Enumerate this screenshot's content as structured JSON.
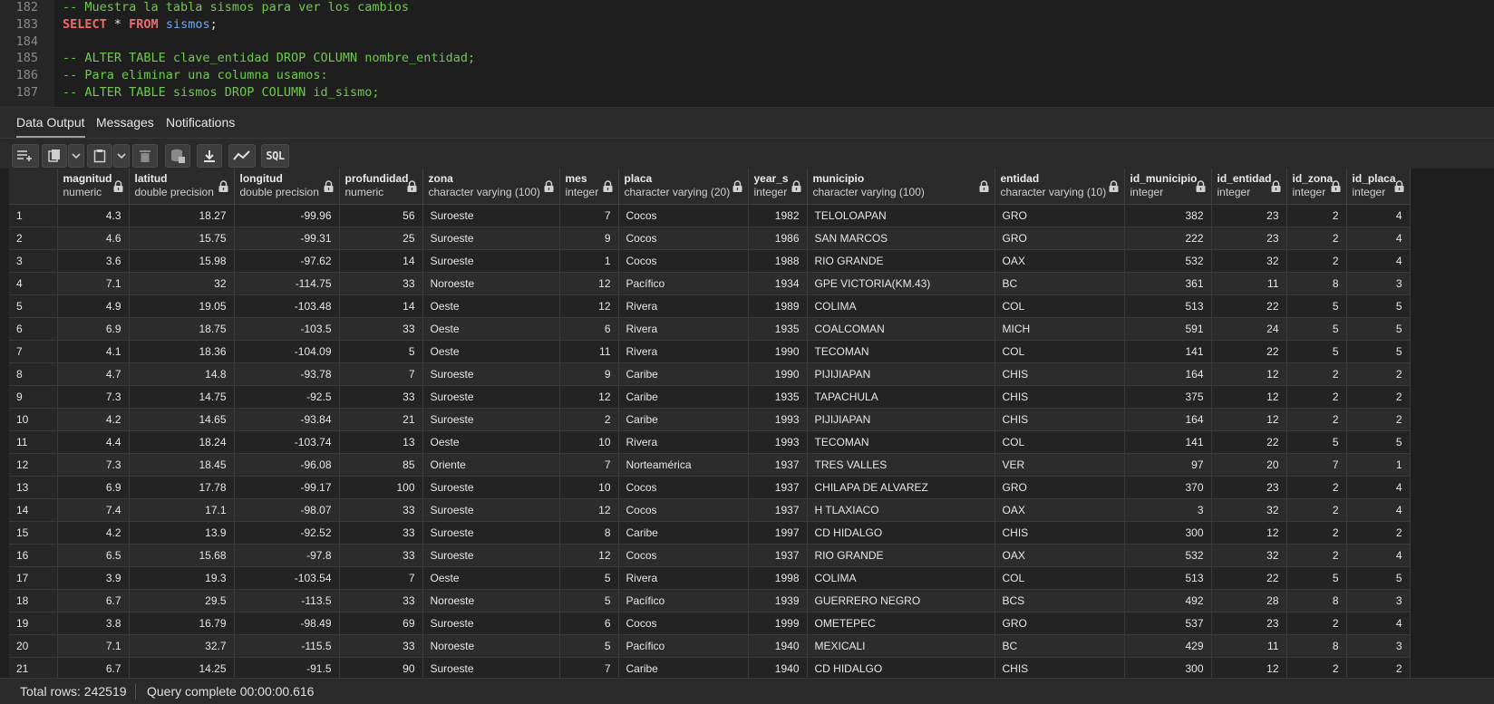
{
  "editor": {
    "lines": [
      {
        "n": "182",
        "tokens": [
          {
            "t": "-- Muestra la tabla sismos para ver los cambios",
            "c": "comment"
          }
        ]
      },
      {
        "n": "183",
        "tokens": [
          {
            "t": "SELECT",
            "c": "kw"
          },
          {
            "t": " * ",
            "c": "op"
          },
          {
            "t": "FROM",
            "c": "kw"
          },
          {
            "t": " sismos",
            "c": "id"
          },
          {
            "t": ";",
            "c": "op"
          }
        ]
      },
      {
        "n": "184",
        "tokens": []
      },
      {
        "n": "185",
        "tokens": [
          {
            "t": "-- ALTER TABLE clave_entidad DROP COLUMN nombre_entidad;",
            "c": "comment"
          }
        ]
      },
      {
        "n": "186",
        "tokens": [
          {
            "t": "-- Para eliminar una columna usamos:",
            "c": "comment"
          }
        ]
      },
      {
        "n": "187",
        "tokens": [
          {
            "t": "-- ALTER TABLE sismos DROP COLUMN id_sismo;",
            "c": "comment"
          }
        ]
      }
    ]
  },
  "tabs": [
    {
      "label": "Data Output",
      "active": true
    },
    {
      "label": "Messages",
      "active": false
    },
    {
      "label": "Notifications",
      "active": false
    }
  ],
  "toolbar": {
    "sql_label": "SQL",
    "buttons": [
      "add-row-icon",
      "copy-icon",
      "dropdown-icon",
      "paste-icon",
      "dropdown-icon",
      "delete-icon",
      "save-data-icon",
      "download-icon",
      "graph-visualiser-icon",
      "sql-icon"
    ]
  },
  "grid": {
    "columns": [
      {
        "name": "magnitud",
        "type": "numeric",
        "align": "num"
      },
      {
        "name": "latitud",
        "type": "double precision",
        "align": "num"
      },
      {
        "name": "longitud",
        "type": "double precision",
        "align": "num"
      },
      {
        "name": "profundidad",
        "type": "numeric",
        "align": "num"
      },
      {
        "name": "zona",
        "type": "character varying (100)",
        "align": "text"
      },
      {
        "name": "mes",
        "type": "integer",
        "align": "num"
      },
      {
        "name": "placa",
        "type": "character varying (20)",
        "align": "text"
      },
      {
        "name": "year_s",
        "type": "integer",
        "align": "num"
      },
      {
        "name": "municipio",
        "type": "character varying (100)",
        "align": "text"
      },
      {
        "name": "entidad",
        "type": "character varying (10)",
        "align": "text"
      },
      {
        "name": "id_municipio",
        "type": "integer",
        "align": "num"
      },
      {
        "name": "id_entidad",
        "type": "integer",
        "align": "num"
      },
      {
        "name": "id_zona",
        "type": "integer",
        "align": "num"
      },
      {
        "name": "id_placa",
        "type": "integer",
        "align": "num"
      }
    ],
    "rows": [
      [
        "1",
        "4.3",
        "18.27",
        "-99.96",
        "56",
        "Suroeste",
        "7",
        "Cocos",
        "1982",
        "TELOLOAPAN",
        "GRO",
        "382",
        "23",
        "2",
        "4"
      ],
      [
        "2",
        "4.6",
        "15.75",
        "-99.31",
        "25",
        "Suroeste",
        "9",
        "Cocos",
        "1986",
        "SAN MARCOS",
        "GRO",
        "222",
        "23",
        "2",
        "4"
      ],
      [
        "3",
        "3.6",
        "15.98",
        "-97.62",
        "14",
        "Suroeste",
        "1",
        "Cocos",
        "1988",
        "RIO GRANDE",
        "OAX",
        "532",
        "32",
        "2",
        "4"
      ],
      [
        "4",
        "7.1",
        "32",
        "-114.75",
        "33",
        "Noroeste",
        "12",
        "Pacífico",
        "1934",
        "GPE VICTORIA(KM.43)",
        "BC",
        "361",
        "11",
        "8",
        "3"
      ],
      [
        "5",
        "4.9",
        "19.05",
        "-103.48",
        "14",
        "Oeste",
        "12",
        "Rivera",
        "1989",
        "COLIMA",
        "COL",
        "513",
        "22",
        "5",
        "5"
      ],
      [
        "6",
        "6.9",
        "18.75",
        "-103.5",
        "33",
        "Oeste",
        "6",
        "Rivera",
        "1935",
        "COALCOMAN",
        "MICH",
        "591",
        "24",
        "5",
        "5"
      ],
      [
        "7",
        "4.1",
        "18.36",
        "-104.09",
        "5",
        "Oeste",
        "11",
        "Rivera",
        "1990",
        "TECOMAN",
        "COL",
        "141",
        "22",
        "5",
        "5"
      ],
      [
        "8",
        "4.7",
        "14.8",
        "-93.78",
        "7",
        "Suroeste",
        "9",
        "Caribe",
        "1990",
        "PIJIJIAPAN",
        "CHIS",
        "164",
        "12",
        "2",
        "2"
      ],
      [
        "9",
        "7.3",
        "14.75",
        "-92.5",
        "33",
        "Suroeste",
        "12",
        "Caribe",
        "1935",
        "TAPACHULA",
        "CHIS",
        "375",
        "12",
        "2",
        "2"
      ],
      [
        "10",
        "4.2",
        "14.65",
        "-93.84",
        "21",
        "Suroeste",
        "2",
        "Caribe",
        "1993",
        "PIJIJIAPAN",
        "CHIS",
        "164",
        "12",
        "2",
        "2"
      ],
      [
        "11",
        "4.4",
        "18.24",
        "-103.74",
        "13",
        "Oeste",
        "10",
        "Rivera",
        "1993",
        "TECOMAN",
        "COL",
        "141",
        "22",
        "5",
        "5"
      ],
      [
        "12",
        "7.3",
        "18.45",
        "-96.08",
        "85",
        "Oriente",
        "7",
        "Norteamérica",
        "1937",
        "TRES VALLES",
        "VER",
        "97",
        "20",
        "7",
        "1"
      ],
      [
        "13",
        "6.9",
        "17.78",
        "-99.17",
        "100",
        "Suroeste",
        "10",
        "Cocos",
        "1937",
        "CHILAPA DE ALVAREZ",
        "GRO",
        "370",
        "23",
        "2",
        "4"
      ],
      [
        "14",
        "7.4",
        "17.1",
        "-98.07",
        "33",
        "Suroeste",
        "12",
        "Cocos",
        "1937",
        "H TLAXIACO",
        "OAX",
        "3",
        "32",
        "2",
        "4"
      ],
      [
        "15",
        "4.2",
        "13.9",
        "-92.52",
        "33",
        "Suroeste",
        "8",
        "Caribe",
        "1997",
        "CD HIDALGO",
        "CHIS",
        "300",
        "12",
        "2",
        "2"
      ],
      [
        "16",
        "6.5",
        "15.68",
        "-97.8",
        "33",
        "Suroeste",
        "12",
        "Cocos",
        "1937",
        "RIO GRANDE",
        "OAX",
        "532",
        "32",
        "2",
        "4"
      ],
      [
        "17",
        "3.9",
        "19.3",
        "-103.54",
        "7",
        "Oeste",
        "5",
        "Rivera",
        "1998",
        "COLIMA",
        "COL",
        "513",
        "22",
        "5",
        "5"
      ],
      [
        "18",
        "6.7",
        "29.5",
        "-113.5",
        "33",
        "Noroeste",
        "5",
        "Pacífico",
        "1939",
        "GUERRERO NEGRO",
        "BCS",
        "492",
        "28",
        "8",
        "3"
      ],
      [
        "19",
        "3.8",
        "16.79",
        "-98.49",
        "69",
        "Suroeste",
        "6",
        "Cocos",
        "1999",
        "OMETEPEC",
        "GRO",
        "537",
        "23",
        "2",
        "4"
      ],
      [
        "20",
        "7.1",
        "32.7",
        "-115.5",
        "33",
        "Noroeste",
        "5",
        "Pacífico",
        "1940",
        "MEXICALI",
        "BC",
        "429",
        "11",
        "8",
        "3"
      ],
      [
        "21",
        "6.7",
        "14.25",
        "-91.5",
        "90",
        "Suroeste",
        "7",
        "Caribe",
        "1940",
        "CD HIDALGO",
        "CHIS",
        "300",
        "12",
        "2",
        "2"
      ]
    ]
  },
  "status": {
    "total_rows": "Total rows: 242519",
    "query": "Query complete 00:00:00.616"
  },
  "colors": {
    "comment": "#6fc94c",
    "keyword": "#ef6a6a",
    "identifier": "#6fa8ef",
    "background": "#1f1f1f"
  }
}
